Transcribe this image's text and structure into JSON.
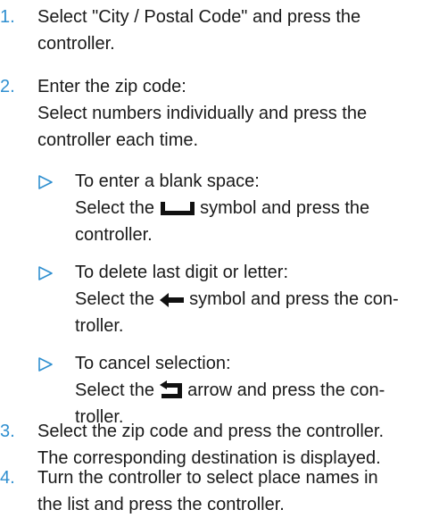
{
  "accent_color": "#2f8fd0",
  "steps": [
    {
      "number": "1.",
      "lines": [
        "Select \"City / Postal Code\" and press the",
        "controller."
      ]
    },
    {
      "number": "2.",
      "lines": [
        "Enter the zip code:",
        "Select numbers individually and press the",
        "controller each time."
      ]
    },
    {
      "number": "3.",
      "lines": [
        "Select the zip code and press the controller.",
        "The corresponding destination is displayed."
      ]
    },
    {
      "number": "4.",
      "lines": [
        "Turn the controller to select place names in",
        "the list and press the controller."
      ]
    }
  ],
  "sub_bullets": [
    {
      "icon": "triangle-right-icon",
      "line1": "To enter a blank space:",
      "line2_before": "Select the",
      "symbol": "space-bar-icon",
      "line2_after": "symbol and press the",
      "line3": "controller."
    },
    {
      "icon": "triangle-right-icon",
      "line1": "To delete last digit or letter:",
      "line2_before": "Select the",
      "symbol": "left-arrow-icon",
      "line2_after": "symbol and press the con-",
      "line3": "troller."
    },
    {
      "icon": "triangle-right-icon",
      "line1": "To cancel selection:",
      "line2_before": "Select the",
      "symbol": "return-arrow-icon",
      "line2_after": "arrow and press the con-",
      "line3": "troller."
    }
  ]
}
